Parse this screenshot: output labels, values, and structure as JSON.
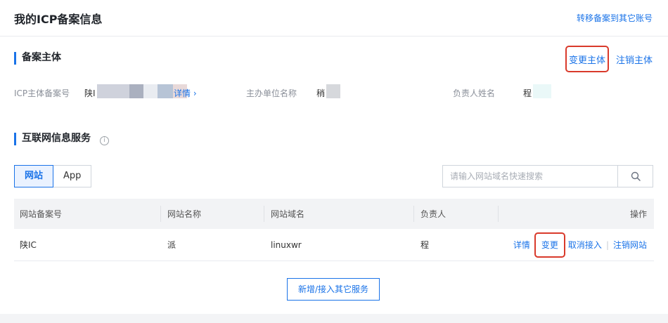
{
  "header": {
    "title": "我的ICP备案信息",
    "transfer_link": "转移备案到其它账号"
  },
  "subject": {
    "section_title": "备案主体",
    "change_label": "变更主体",
    "cancel_label": "注销主体",
    "icp_label": "ICP主体备案号",
    "icp_value_prefix": "陕I",
    "detail_link": "详情",
    "org_label": "主办单位名称",
    "org_value_prefix": "稍",
    "owner_label": "负责人姓名",
    "owner_value_prefix": "程"
  },
  "services": {
    "section_title": "互联网信息服务",
    "tabs": [
      {
        "label": "网站",
        "active": true
      },
      {
        "label": "App",
        "active": false
      }
    ],
    "search_placeholder": "请输入网站域名快速搜索",
    "columns": [
      "网站备案号",
      "网站名称",
      "网站域名",
      "负责人",
      "操作"
    ],
    "rows": [
      {
        "record_no": "陕IC",
        "site_name": "派",
        "domain": "linuxwr",
        "owner": "程",
        "actions": [
          "详情",
          "变更",
          "取消接入",
          "注销网站"
        ]
      }
    ],
    "add_button": "新增/接入其它服务"
  },
  "colors": {
    "accent": "#1a73e8",
    "highlight_box": "#d93a2b"
  }
}
